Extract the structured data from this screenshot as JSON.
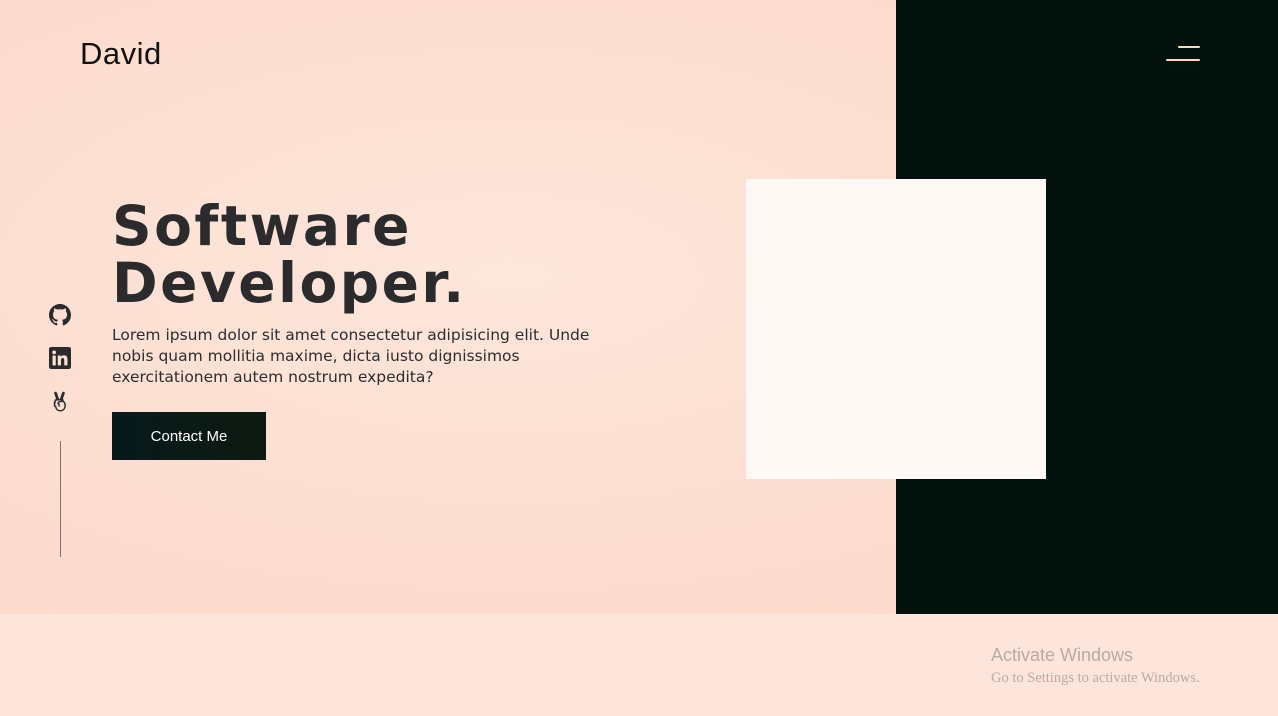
{
  "header": {
    "logo_text": "David",
    "menu_icon": "hamburger-menu-icon"
  },
  "hero": {
    "headline_line1": "Software",
    "headline_line2": "Developer.",
    "lead": "Lorem ipsum dolor sit amet consectetur adipisicing elit. Unde nobis quam mollitia maxime, dicta iusto dignissimos exercitationem autem nostrum expedita?",
    "cta_label": "Contact Me"
  },
  "social": [
    {
      "icon": "github-icon"
    },
    {
      "icon": "linkedin-icon"
    },
    {
      "icon": "angellist-icon"
    }
  ],
  "watermark": {
    "title": "Activate Windows",
    "subtitle": "Go to Settings to activate Windows."
  },
  "colors": {
    "hero_bg": "#fddccf",
    "dark_panel": "#02110c",
    "image_placeholder": "#fff9f5",
    "text_dark": "#2b2b2d",
    "menu_accent": "#fdd9c9"
  }
}
